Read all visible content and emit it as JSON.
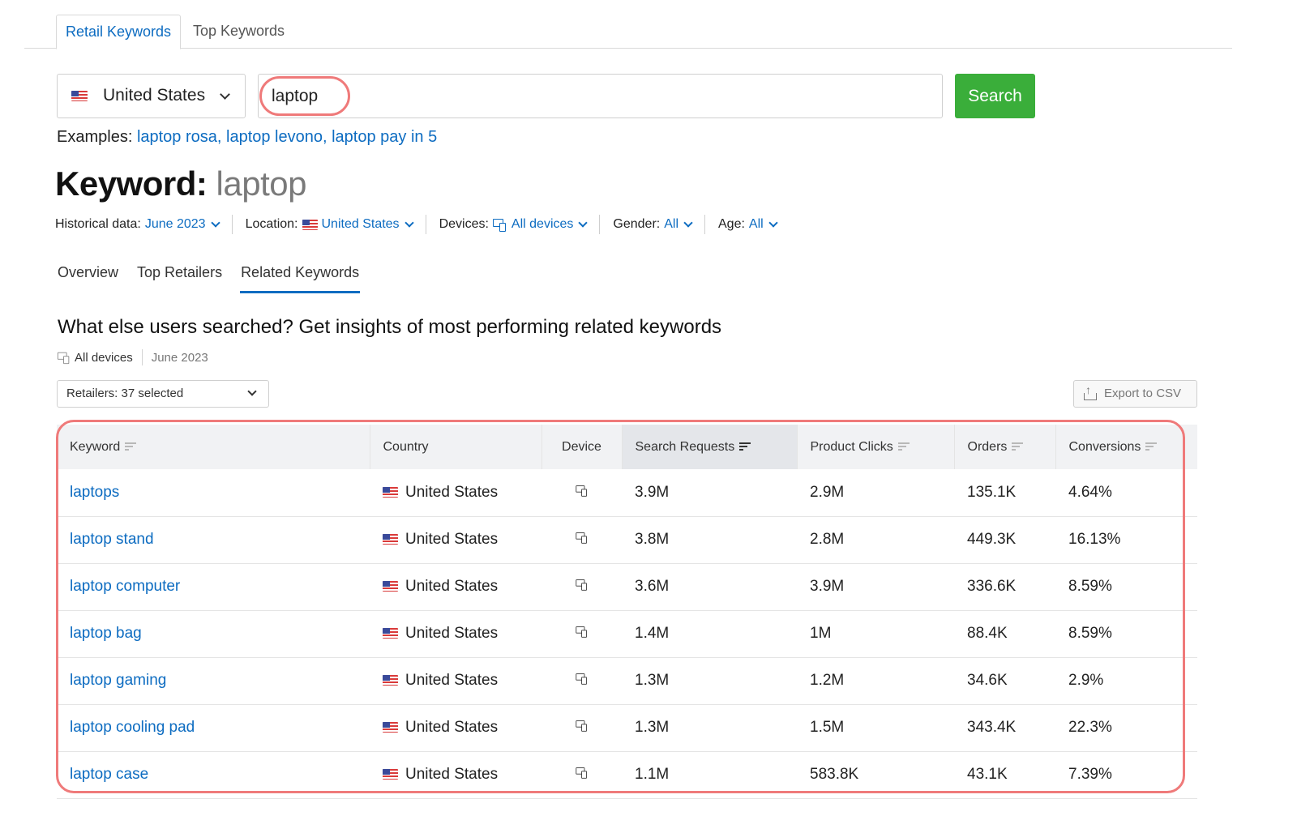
{
  "top_tabs": {
    "retail": "Retail Keywords",
    "top": "Top Keywords"
  },
  "search": {
    "country": "United States",
    "query": "laptop",
    "button": "Search",
    "examples_label": "Examples:",
    "examples": "laptop rosa, laptop levono, laptop pay in 5"
  },
  "keyword": {
    "label": "Keyword:",
    "value": "laptop"
  },
  "filters": {
    "historical_label": "Historical data:",
    "historical_value": "June 2023",
    "location_label": "Location:",
    "location_value": "United States",
    "devices_label": "Devices:",
    "devices_value": "All devices",
    "gender_label": "Gender:",
    "gender_value": "All",
    "age_label": "Age:",
    "age_value": "All"
  },
  "section_tabs": {
    "overview": "Overview",
    "retailers": "Top Retailers",
    "related": "Related Keywords"
  },
  "section": {
    "heading": "What else users searched? Get insights of most performing related keywords",
    "devices": "All devices",
    "date": "June 2023",
    "retailers_select": "Retailers: 37 selected",
    "export": "Export to CSV"
  },
  "table": {
    "headers": [
      "Keyword",
      "Country",
      "Device",
      "Search Requests",
      "Product Clicks",
      "Orders",
      "Conversions"
    ],
    "rows": [
      {
        "keyword": "laptops",
        "country": "United States",
        "search_requests": "3.9M",
        "product_clicks": "2.9M",
        "orders": "135.1K",
        "conversions": "4.64%"
      },
      {
        "keyword": "laptop stand",
        "country": "United States",
        "search_requests": "3.8M",
        "product_clicks": "2.8M",
        "orders": "449.3K",
        "conversions": "16.13%"
      },
      {
        "keyword": "laptop computer",
        "country": "United States",
        "search_requests": "3.6M",
        "product_clicks": "3.9M",
        "orders": "336.6K",
        "conversions": "8.59%"
      },
      {
        "keyword": "laptop bag",
        "country": "United States",
        "search_requests": "1.4M",
        "product_clicks": "1M",
        "orders": "88.4K",
        "conversions": "8.59%"
      },
      {
        "keyword": "laptop gaming",
        "country": "United States",
        "search_requests": "1.3M",
        "product_clicks": "1.2M",
        "orders": "34.6K",
        "conversions": "2.9%"
      },
      {
        "keyword": "laptop cooling pad",
        "country": "United States",
        "search_requests": "1.3M",
        "product_clicks": "1.5M",
        "orders": "343.4K",
        "conversions": "22.3%"
      },
      {
        "keyword": "laptop case",
        "country": "United States",
        "search_requests": "1.1M",
        "product_clicks": "583.8K",
        "orders": "43.1K",
        "conversions": "7.39%"
      }
    ]
  },
  "colors": {
    "accent": "#0d6cc1",
    "search_button": "#3aae3a",
    "highlight": "#ef7a7a"
  }
}
